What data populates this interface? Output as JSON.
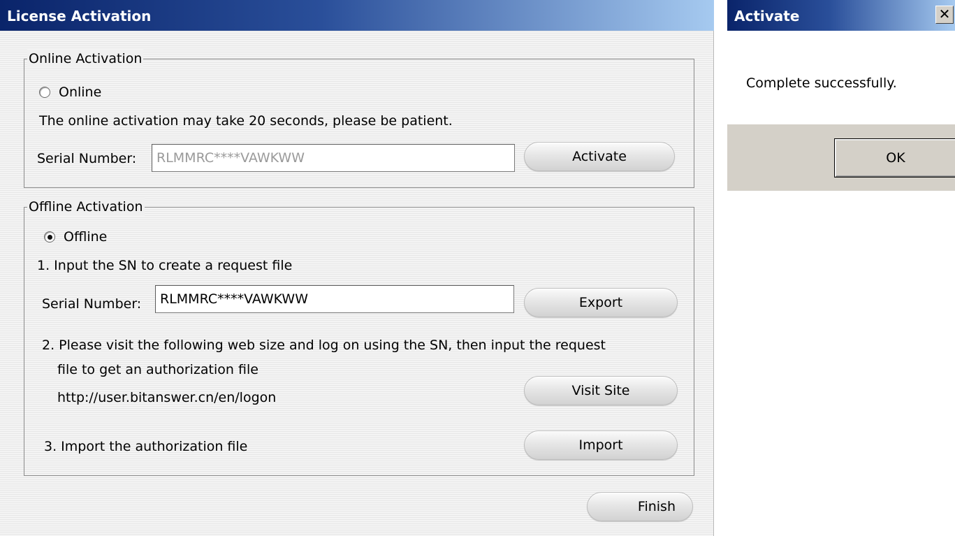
{
  "main_window": {
    "title": "License Activation",
    "online_group": {
      "legend": "Online Activation",
      "radio_label": "Online",
      "radio_selected": false,
      "note": "The online activation may take 20 seconds, please be patient.",
      "serial_label": "Serial Number:",
      "serial_value": "RLMMRC****VAWKWW",
      "activate_label": "Activate"
    },
    "offline_group": {
      "legend": "Offline Activation",
      "radio_label": "Offline",
      "radio_selected": true,
      "step1": "1. Input the SN to create a request file",
      "serial_label": "Serial Number:",
      "serial_value": "RLMMRC****VAWKWW",
      "export_label": "Export",
      "step2_line1": "2. Please visit the following web size and log on using the SN, then input the request",
      "step2_line2": "file to get an authorization file",
      "url": "http://user.bitanswer.cn/en/logon",
      "visit_label": "Visit Site",
      "step3": "3. Import the authorization file",
      "import_label": "Import"
    },
    "finish_label": "Finish"
  },
  "dialog": {
    "title": "Activate",
    "close_glyph": "✕",
    "message": "Complete successfully.",
    "ok_label": "OK"
  }
}
